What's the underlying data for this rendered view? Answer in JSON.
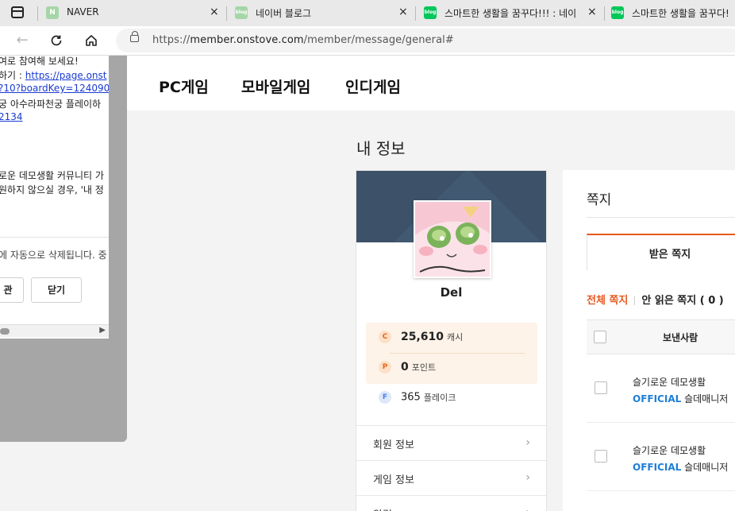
{
  "browser": {
    "tabs": [
      {
        "label": "NAVER",
        "favicon_text": "N",
        "favicon_color": "#a5d6a7"
      },
      {
        "label": "네이버 블로그",
        "favicon_text": "blog",
        "favicon_color": "#a5d6a7"
      },
      {
        "label": "스마트한 생활을 꿈꾸다!!! : 네이",
        "favicon_text": "blog",
        "favicon_color": "#03c75a"
      },
      {
        "label": "스마트한 생활을 꿈꾸다!",
        "favicon_text": "blog",
        "favicon_color": "#03c75a"
      }
    ],
    "tab_close": "×",
    "url_prefix": "https://",
    "url_host": "member.onstove.com",
    "url_path": "/member/message/general#"
  },
  "topnav": {
    "items": [
      "PC게임",
      "모바일게임",
      "인디게임"
    ]
  },
  "page_title": "내 정보",
  "profile": {
    "name": "Del",
    "wallet": [
      {
        "icon": "C",
        "value": "25,610",
        "unit": "캐시"
      },
      {
        "icon": "P",
        "value": "0",
        "unit": "포인트"
      },
      {
        "icon": "F",
        "value": "365",
        "unit": "플레이크"
      }
    ],
    "menu": [
      "회원 정보",
      "게임 정보",
      "알림"
    ]
  },
  "messages": {
    "title": "쪽지",
    "tab_received": "받은 쪽지",
    "filter_all": "전체 쪽지",
    "filter_unread": "안 읽은 쪽지 ( 0 )",
    "column_sender": "보낸사람",
    "rows": [
      {
        "sender": "슬기로운 데모생활",
        "badge": "OFFICIAL",
        "manager": "슬데매니저"
      },
      {
        "sender": "슬기로운 데모생활",
        "badge": "OFFICIAL",
        "manager": "슬데매니저"
      }
    ]
  },
  "modal": {
    "lines": [
      "여로 참여해 보세요!",
      "하기 : ",
      "?10?boardKey=124090",
      "궁 아수라파천궁 플레이하",
      "2134",
      "로운 데모생활 커뮤니티 가",
      "원하지 않으실 경우, '내 정"
    ],
    "link1": "https://page.onst",
    "footer_note": "에 자동으로 삭제됩니다. 중",
    "btn_left": "관",
    "btn_close": "닫기"
  },
  "colors": {
    "accent": "#e8581f",
    "official": "#1e7fd6",
    "banner": "#3d5168"
  }
}
